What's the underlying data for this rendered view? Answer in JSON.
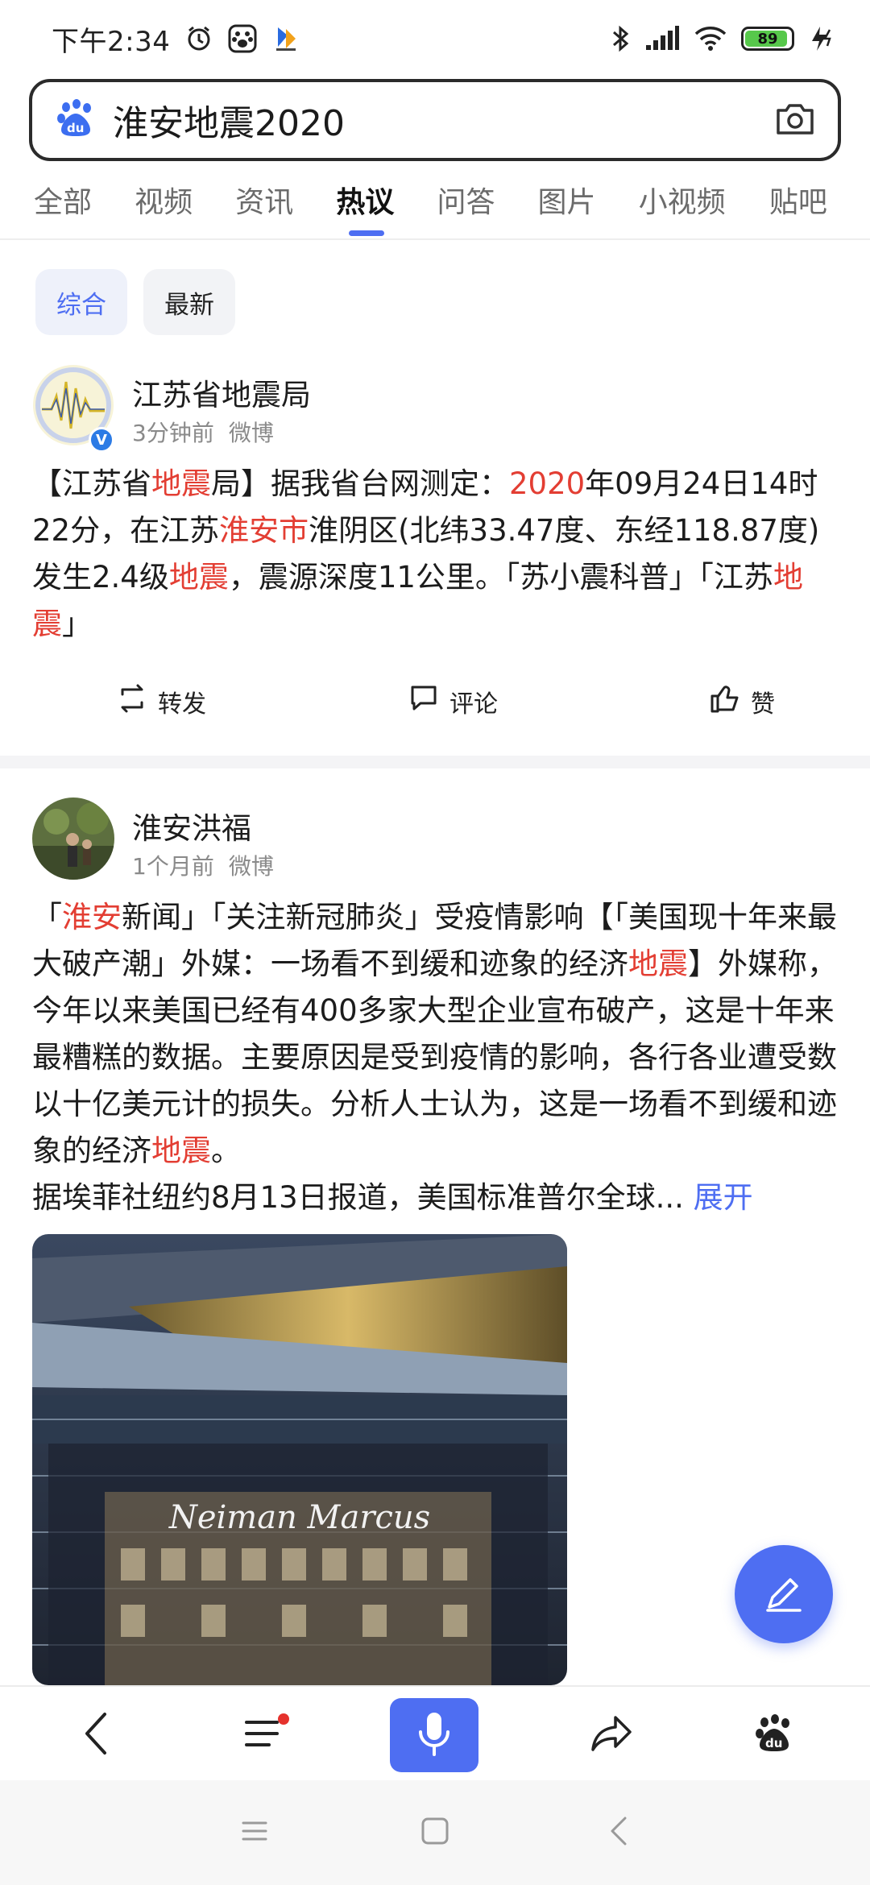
{
  "status_bar": {
    "time": "下午2:34",
    "battery": "89",
    "icons": [
      "alarm-clock-icon",
      "baidu-paw-icon",
      "app-notification-icon",
      "bluetooth-icon",
      "signal-icon",
      "wifi-icon",
      "battery-icon",
      "charging-icon"
    ]
  },
  "search": {
    "query": "淮安地震2020",
    "icons": [
      "baidu-logo-icon",
      "camera-icon"
    ]
  },
  "tabs": [
    "全部",
    "视频",
    "资讯",
    "热议",
    "问答",
    "图片",
    "小视频",
    "贴吧"
  ],
  "active_tab": "热议",
  "filters": [
    "综合",
    "最新"
  ],
  "active_filter": "综合",
  "posts": [
    {
      "author": "江苏省地震局",
      "time": "3分钟前",
      "source": "微博",
      "verified": true,
      "segments": [
        {
          "t": "【江苏省"
        },
        {
          "t": "地震",
          "hl": true
        },
        {
          "t": "局】据我省台网测定："
        },
        {
          "t": "2020",
          "hl": true
        },
        {
          "t": "年09月24日14时22分，在江苏"
        },
        {
          "t": "淮安市",
          "hl": true
        },
        {
          "t": "淮阴区(北纬33.47度、东经118.87度)发生2.4级"
        },
        {
          "t": "地震",
          "hl": true
        },
        {
          "t": "，震源深度11公里。「苏小震科普」「江苏"
        },
        {
          "t": "地震",
          "hl": true
        },
        {
          "t": "」"
        }
      ],
      "actions": {
        "forward": "转发",
        "comment": "评论",
        "like": "赞"
      }
    },
    {
      "author": "淮安洪福",
      "time": "1个月前",
      "source": "微博",
      "segments": [
        {
          "t": "「"
        },
        {
          "t": "淮安",
          "hl": true
        },
        {
          "t": "新闻」「关注新冠肺炎」受疫情影响【「美国现十年来最大破产潮」外媒：一场看不到缓和迹象的经济"
        },
        {
          "t": "地震",
          "hl": true
        },
        {
          "t": "】外媒称，今年以来美国已经有400多家大型企业宣布破产，这是十年来最糟糕的数据。主要原因是受到疫情的影响，各行各业遭受数以十亿美元计的损失。分析人士认为，这是一场看不到缓和迹象的经济"
        },
        {
          "t": "地震",
          "hl": true
        },
        {
          "t": "。\n据埃菲社纽约8月13日报道，美国标准普尔全球..."
        }
      ],
      "more": "展开",
      "image_sign_text": "Neiman Marcus"
    }
  ],
  "colors": {
    "accent": "#4e6ef2",
    "highlight": "#e33e33",
    "meta": "#8a8a8a"
  }
}
